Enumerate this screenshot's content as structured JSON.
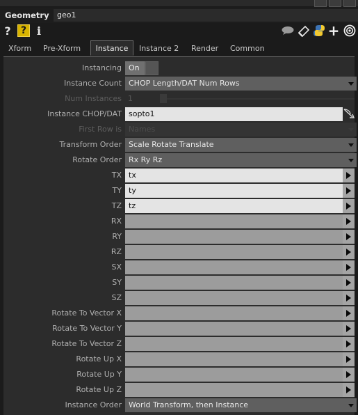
{
  "header": {
    "op_type": "Geometry",
    "op_name": "geo1"
  },
  "toolbar": {
    "help_q": "?",
    "help_box": "?",
    "info": "i",
    "add": "+"
  },
  "tabs": [
    "Xform",
    "Pre-Xform",
    "Instance",
    "Instance 2",
    "Render",
    "Common"
  ],
  "active_tab": "Instance",
  "params": {
    "instancing": {
      "label": "Instancing",
      "value": "On"
    },
    "instance_count": {
      "label": "Instance Count",
      "value": "CHOP Length/DAT Num Rows"
    },
    "num_instances": {
      "label": "Num Instances",
      "value": "1"
    },
    "instance_chop": {
      "label": "Instance CHOP/DAT",
      "value": "sopto1"
    },
    "first_row_is": {
      "label": "First Row is",
      "value": "Names"
    },
    "transform_order": {
      "label": "Transform Order",
      "value": "Scale Rotate Translate"
    },
    "rotate_order": {
      "label": "Rotate Order",
      "value": "Rx Ry Rz"
    },
    "tx": {
      "label": "TX",
      "value": "tx"
    },
    "ty": {
      "label": "TY",
      "value": "ty"
    },
    "tz": {
      "label": "TZ",
      "value": "tz"
    },
    "rx": {
      "label": "RX",
      "value": ""
    },
    "ry": {
      "label": "RY",
      "value": ""
    },
    "rz": {
      "label": "RZ",
      "value": ""
    },
    "sx": {
      "label": "SX",
      "value": ""
    },
    "sy": {
      "label": "SY",
      "value": ""
    },
    "sz": {
      "label": "SZ",
      "value": ""
    },
    "rtvx": {
      "label": "Rotate To Vector X",
      "value": ""
    },
    "rtvy": {
      "label": "Rotate To Vector Y",
      "value": ""
    },
    "rtvz": {
      "label": "Rotate To Vector Z",
      "value": ""
    },
    "rux": {
      "label": "Rotate Up X",
      "value": ""
    },
    "ruy": {
      "label": "Rotate Up Y",
      "value": ""
    },
    "ruz": {
      "label": "Rotate Up Z",
      "value": ""
    },
    "instance_order": {
      "label": "Instance Order",
      "value": "World Transform, then Instance"
    }
  }
}
